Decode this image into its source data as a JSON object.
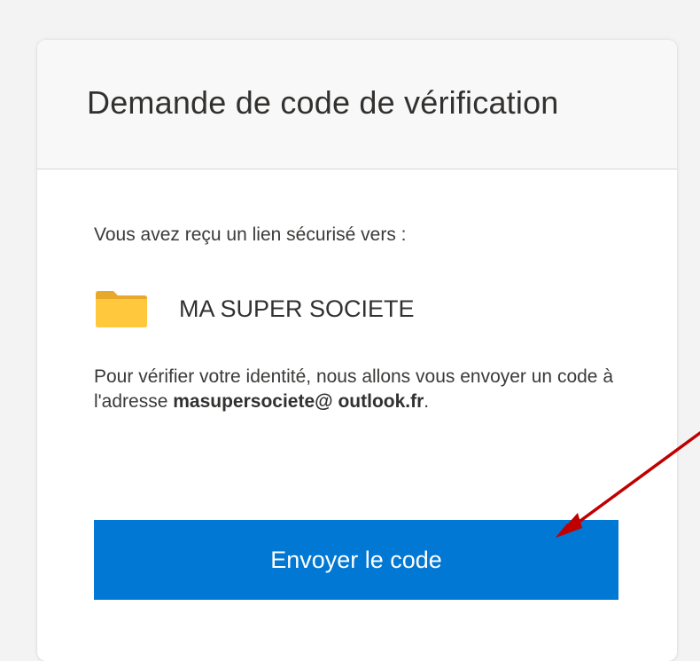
{
  "dialog": {
    "title": "Demande de code de vérification",
    "intro": "Vous avez reçu un lien sécurisé vers :",
    "folder": {
      "icon": "folder-icon",
      "name": "MA SUPER SOCIETE",
      "color": "#ffc83d"
    },
    "description": {
      "prefix": "Pour vérifier votre identité, nous allons vous envoyer un code à l'adresse ",
      "email": "masupersociete@ outlook.fr",
      "suffix": "."
    },
    "send_button": {
      "label": "Envoyer le code",
      "color": "#0078d4"
    }
  },
  "annotation": {
    "type": "arrow",
    "color": "#c00000"
  }
}
